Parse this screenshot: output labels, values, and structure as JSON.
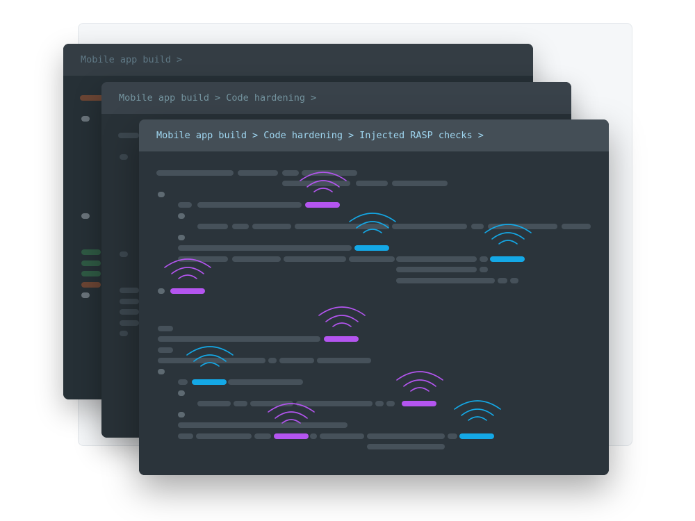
{
  "windows": [
    {
      "breadcrumb": [
        "Mobile app build"
      ],
      "separator": ">"
    },
    {
      "breadcrumb": [
        "Mobile app build",
        "Code hardening"
      ],
      "separator": ">"
    },
    {
      "breadcrumb": [
        "Mobile app build",
        "Code hardening",
        "Injected RASP checks"
      ],
      "separator": ">"
    }
  ],
  "colors": {
    "signal_purple": "#b455f0",
    "signal_blue": "#14a8e6",
    "window_front_title": "#9fd6f0",
    "editor_background": "#2b343b"
  },
  "icons": {
    "signal": "wifi-signal-icon"
  }
}
